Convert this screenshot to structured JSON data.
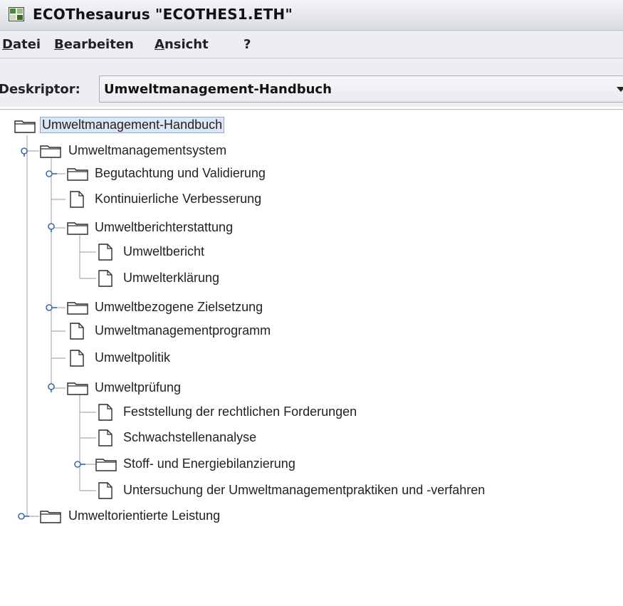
{
  "window": {
    "title": "ECOThesaurus  \"ECOTHES1.ETH\""
  },
  "menubar": {
    "items": [
      {
        "mnemonic": "D",
        "rest": "atei"
      },
      {
        "mnemonic": "B",
        "rest": "earbeiten"
      },
      {
        "mnemonic": "A",
        "rest": "nsicht"
      },
      {
        "mnemonic": "",
        "rest": "?"
      }
    ]
  },
  "descriptor": {
    "label": "Deskriptor:",
    "value": "Umweltmanagement-Handbuch"
  },
  "tree": {
    "nodes": [
      {
        "label": "Umweltmanagement-Handbuch",
        "type": "folder",
        "selected": true
      },
      {
        "label": "Umweltmanagementsystem",
        "type": "folder",
        "expanded": true
      },
      {
        "label": "Begutachtung und Validierung",
        "type": "folder",
        "expanded": false
      },
      {
        "label": "Kontinuierliche Verbesserung",
        "type": "doc"
      },
      {
        "label": "Umweltberichterstattung",
        "type": "folder",
        "expanded": true
      },
      {
        "label": "Umweltbericht",
        "type": "doc"
      },
      {
        "label": "Umwelterklärung",
        "type": "doc"
      },
      {
        "label": "Umweltbezogene Zielsetzung",
        "type": "folder",
        "expanded": false
      },
      {
        "label": "Umweltmanagementprogramm",
        "type": "doc"
      },
      {
        "label": "Umweltpolitik",
        "type": "doc"
      },
      {
        "label": "Umweltprüfung",
        "type": "folder",
        "expanded": true
      },
      {
        "label": "Feststellung der rechtlichen Forderungen",
        "type": "doc"
      },
      {
        "label": "Schwachstellenanalyse",
        "type": "doc"
      },
      {
        "label": "Stoff- und Energiebilanzierung",
        "type": "folder",
        "expanded": false
      },
      {
        "label": "Untersuchung der Umweltmanagementpraktiken und -verfahren",
        "type": "doc"
      },
      {
        "label": "Umweltorientierte Leistung",
        "type": "folder",
        "expanded": false
      }
    ]
  }
}
